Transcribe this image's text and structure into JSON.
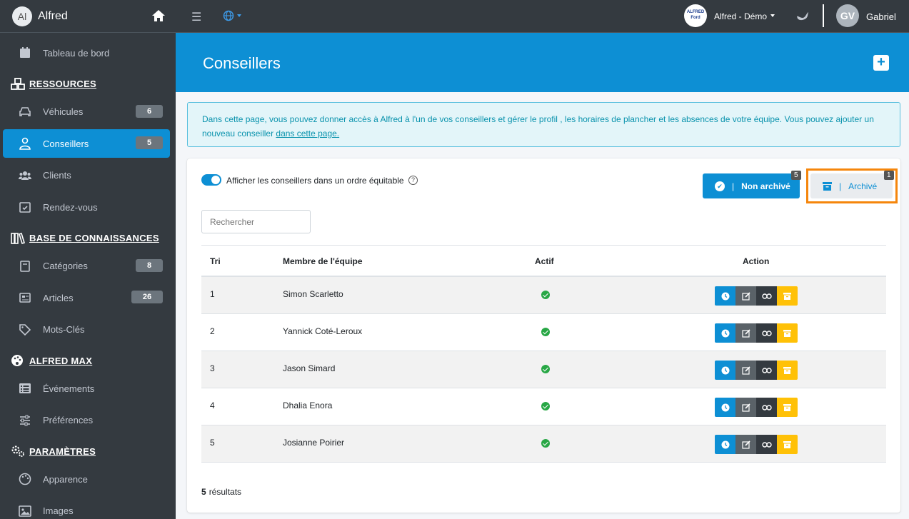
{
  "brand": {
    "initials": "Al",
    "name": "Alfred"
  },
  "sidebar": {
    "items": [
      {
        "label": "Tableau de bord",
        "icon": "calendar-icon"
      },
      {
        "header": "RESSOURCES",
        "icon": "cubes-icon"
      },
      {
        "label": "Véhicules",
        "icon": "car-icon",
        "badge": "6"
      },
      {
        "label": "Conseillers",
        "icon": "user-tie-icon",
        "badge": "5",
        "active": true
      },
      {
        "label": "Clients",
        "icon": "users-icon"
      },
      {
        "label": "Rendez-vous",
        "icon": "calendar-check-icon"
      },
      {
        "header": "BASE DE CONNAISSANCES",
        "icon": "book-icon"
      },
      {
        "label": "Catégories",
        "icon": "book-open-icon",
        "badge": "8"
      },
      {
        "label": "Articles",
        "icon": "newspaper-icon",
        "badge": "26"
      },
      {
        "label": "Mots-Clés",
        "icon": "tag-icon"
      },
      {
        "header": "ALFRED MAX",
        "icon": "palette-icon"
      },
      {
        "label": "Événements",
        "icon": "list-icon"
      },
      {
        "label": "Préférences",
        "icon": "sliders-icon"
      },
      {
        "header": "PARAMÈTRES",
        "icon": "cogs-icon"
      },
      {
        "label": "Apparence",
        "icon": "palette-icon"
      },
      {
        "label": "Images",
        "icon": "image-icon"
      }
    ]
  },
  "topbar": {
    "org_logo_text": "ALFRED Ford",
    "org_name": "Alfred - Démo",
    "user_initials": "GV",
    "user_name": "Gabriel"
  },
  "page": {
    "title": "Conseillers"
  },
  "info": {
    "text": "Dans cette page, vous pouvez donner accès à Alfred à l'un de vos conseillers et gérer le profil , les horaires de plancher et les absences de votre équipe. Vous pouvez ajouter un nouveau conseiller ",
    "link": "dans cette page."
  },
  "controls": {
    "toggle_label": "Afficher les conseillers dans un ordre équitable",
    "help": "?",
    "non_archive_label": "Non archivé",
    "non_archive_count": "5",
    "archive_label": "Archivé",
    "archive_count": "1",
    "separator": "|",
    "search_placeholder": "Rechercher"
  },
  "table": {
    "headers": [
      "Tri",
      "Membre de l'équipe",
      "Actif",
      "Action"
    ],
    "rows": [
      {
        "tri": "1",
        "name": "Simon Scarletto"
      },
      {
        "tri": "2",
        "name": "Yannick Coté-Leroux"
      },
      {
        "tri": "3",
        "name": "Jason Simard"
      },
      {
        "tri": "4",
        "name": "Dhalia Enora"
      },
      {
        "tri": "5",
        "name": "Josianne Poirier"
      }
    ]
  },
  "footer": {
    "count": "5",
    "label": "résultats"
  },
  "colors": {
    "accent": "#0d8fd4",
    "sidebar": "#343a40",
    "highlight": "#f5860c",
    "success": "#28a745",
    "warning": "#ffc107"
  }
}
